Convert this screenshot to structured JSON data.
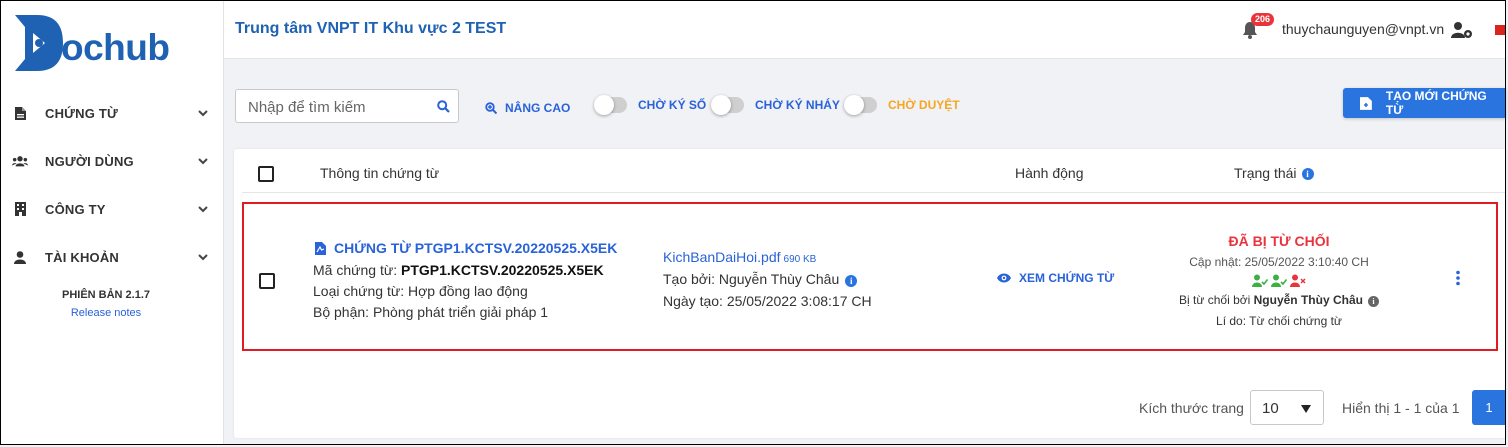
{
  "brand": {
    "logo_text": "ochub"
  },
  "sidebar": {
    "items": [
      {
        "label": "CHỨNG TỪ",
        "icon": "document-icon"
      },
      {
        "label": "NGƯỜI DÙNG",
        "icon": "users-icon"
      },
      {
        "label": "CÔNG TY",
        "icon": "building-icon"
      },
      {
        "label": "TÀI KHOẢN",
        "icon": "user-icon"
      }
    ],
    "version": "PHIÊN BẢN 2.1.7",
    "release_notes": "Release notes"
  },
  "header": {
    "title": "Trung tâm VNPT IT Khu vực 2 TEST",
    "notification_count": "206",
    "user_email": "thuychaunguyen@vnpt.vn"
  },
  "toolbar": {
    "search_placeholder": "Nhập để tìm kiếm",
    "advanced_label": "NÂNG CAO",
    "filters": [
      {
        "label": "CHỜ KÝ SỐ",
        "color": "#2962d9"
      },
      {
        "label": "CHỜ KÝ NHÁY",
        "color": "#2962d9"
      },
      {
        "label": "CHỜ DUYỆT",
        "color": "#f5a623"
      }
    ],
    "create_label": "TẠO MỚI CHỨNG TỪ"
  },
  "table": {
    "headers": {
      "info": "Thông tin chứng từ",
      "action": "Hành động",
      "status": "Trạng thái"
    },
    "rows": [
      {
        "title": "CHỨNG TỪ PTGP1.KCTSV.20220525.X5EK",
        "code_label": "Mã chứng từ: ",
        "code": "PTGP1.KCTSV.20220525.X5EK",
        "type": "Loại chứng từ: Hợp đồng lao động",
        "department": "Bộ phận: Phòng phát triển giải pháp 1",
        "file_name": "KichBanDaiHoi.pdf",
        "file_size": "690 KB",
        "created_by": "Tạo bởi: Nguyễn Thùy Châu",
        "created_at": "Ngày tạo: 25/05/2022 3:08:17 CH",
        "action_label": "XEM CHỨNG TỪ",
        "status": "ĐÃ BỊ TỪ CHỐI",
        "updated": "Cập nhật: 25/05/2022 3:10:40 CH",
        "rejected_by_label": "Bị từ chối bởi ",
        "rejected_by": "Nguyễn Thùy Châu",
        "reason": "Lí do: Từ chối chứng từ",
        "signers": [
          {
            "state": "approved",
            "color": "#3cb043"
          },
          {
            "state": "approved",
            "color": "#3cb043"
          },
          {
            "state": "rejected",
            "color": "#e8343d"
          }
        ]
      }
    ]
  },
  "pagination": {
    "page_size_label": "Kích thước trang",
    "page_size": "10",
    "range": "Hiển thị 1 - 1 của 1",
    "current_page": "1"
  },
  "colors": {
    "primary": "#2a74e0",
    "danger": "#e8343d",
    "warning": "#f5a623",
    "success": "#3cb043"
  }
}
